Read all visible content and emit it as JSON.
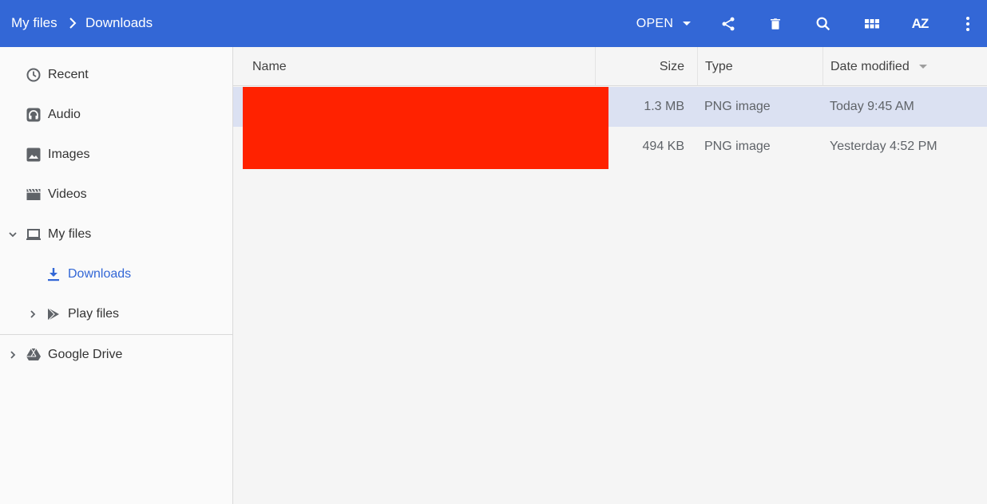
{
  "breadcrumb": {
    "root": "My files",
    "current": "Downloads"
  },
  "toolbar": {
    "open_label": "OPEN",
    "sort_icon_text": "AZ",
    "icons": [
      "share-icon",
      "delete-icon",
      "search-icon",
      "grid-view-icon",
      "sort-az-icon",
      "more-vert-icon"
    ]
  },
  "sidebar": {
    "items": [
      {
        "label": "Recent",
        "icon": "clock-icon"
      },
      {
        "label": "Audio",
        "icon": "headphones-icon"
      },
      {
        "label": "Images",
        "icon": "image-icon"
      },
      {
        "label": "Videos",
        "icon": "video-icon"
      },
      {
        "label": "My files",
        "icon": "laptop-icon"
      },
      {
        "label": "Downloads",
        "icon": "download-icon"
      },
      {
        "label": "Play files",
        "icon": "play-store-icon"
      },
      {
        "label": "Google Drive",
        "icon": "drive-icon"
      }
    ]
  },
  "table": {
    "columns": {
      "name": "Name",
      "size": "Size",
      "type": "Type",
      "date": "Date modified"
    },
    "rows": [
      {
        "size": "1.3 MB",
        "type": "PNG image",
        "date": "Today 9:45 AM"
      },
      {
        "size": "494 KB",
        "type": "PNG image",
        "date": "Yesterday 4:52 PM"
      }
    ]
  },
  "colors": {
    "accent": "#3367d6",
    "selection": "#dbe1f2",
    "redaction": "#ff2200"
  }
}
